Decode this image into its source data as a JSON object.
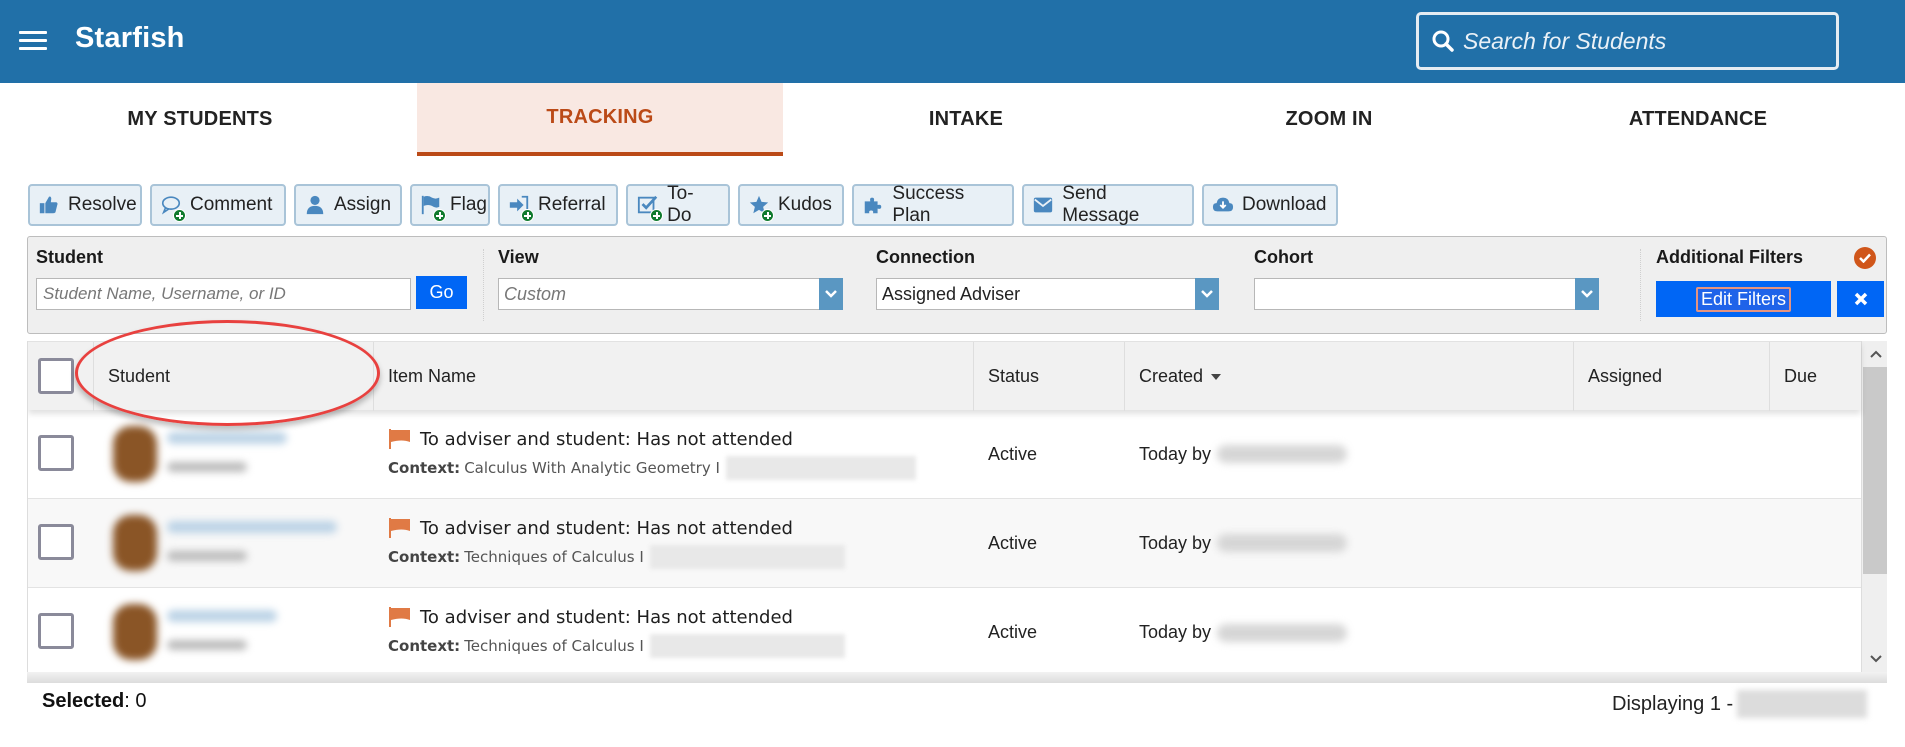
{
  "header": {
    "app_title": "Starfish",
    "menu_icon": "hamburger-menu-icon",
    "search_placeholder": "Search for Students",
    "search_icon": "search-icon",
    "brand_color": "#2170a8"
  },
  "tabs": [
    {
      "label": "MY STUDENTS",
      "active": false
    },
    {
      "label": "TRACKING",
      "active": true
    },
    {
      "label": "INTAKE",
      "active": false
    },
    {
      "label": "ZOOM IN",
      "active": false
    },
    {
      "label": "ATTENDANCE",
      "active": false
    }
  ],
  "active_tab_color": "#bb4a17",
  "toolbar": [
    {
      "label": "Resolve",
      "icon": "thumbs-up-icon"
    },
    {
      "label": "Comment",
      "icon": "comment-add-icon"
    },
    {
      "label": "Assign",
      "icon": "user-icon"
    },
    {
      "label": "Flag",
      "icon": "flag-add-icon"
    },
    {
      "label": "Referral",
      "icon": "referral-add-icon"
    },
    {
      "label": "To-Do",
      "icon": "todo-add-icon"
    },
    {
      "label": "Kudos",
      "icon": "star-add-icon"
    },
    {
      "label": "Success Plan",
      "icon": "puzzle-icon"
    },
    {
      "label": "Send Message",
      "icon": "envelope-icon"
    },
    {
      "label": "Download",
      "icon": "cloud-download-icon"
    }
  ],
  "filters": {
    "student": {
      "label": "Student",
      "placeholder": "Student Name, Username, or ID",
      "value": "",
      "go_label": "Go"
    },
    "view": {
      "label": "View",
      "value": "Custom"
    },
    "connection": {
      "label": "Connection",
      "value": "Assigned Adviser"
    },
    "cohort": {
      "label": "Cohort",
      "value": ""
    },
    "additional": {
      "label": "Additional Filters",
      "edit_label": "Edit Filters",
      "status_icon": "check-circle-icon",
      "clear_icon": "close-icon"
    }
  },
  "table": {
    "columns": [
      "Student",
      "Item Name",
      "Status",
      "Created",
      "Assigned",
      "Due"
    ],
    "sorted_by": "Created",
    "rows": [
      {
        "item_title": "To adviser and student: Has not attended",
        "context_label": "Context:",
        "context": "Calculus With Analytic Geometry I",
        "status": "Active",
        "created": "Today by",
        "assigned": "",
        "due": ""
      },
      {
        "item_title": "To adviser and student: Has not attended",
        "context_label": "Context:",
        "context": "Techniques of Calculus I",
        "status": "Active",
        "created": "Today by",
        "assigned": "",
        "due": ""
      },
      {
        "item_title": "To adviser and student: Has not attended",
        "context_label": "Context:",
        "context": "Techniques of Calculus I",
        "status": "Active",
        "created": "Today by",
        "assigned": "",
        "due": ""
      }
    ]
  },
  "footer": {
    "selected_label": "Selected",
    "selected_count": ": 0",
    "displaying": "Displaying 1 -"
  }
}
